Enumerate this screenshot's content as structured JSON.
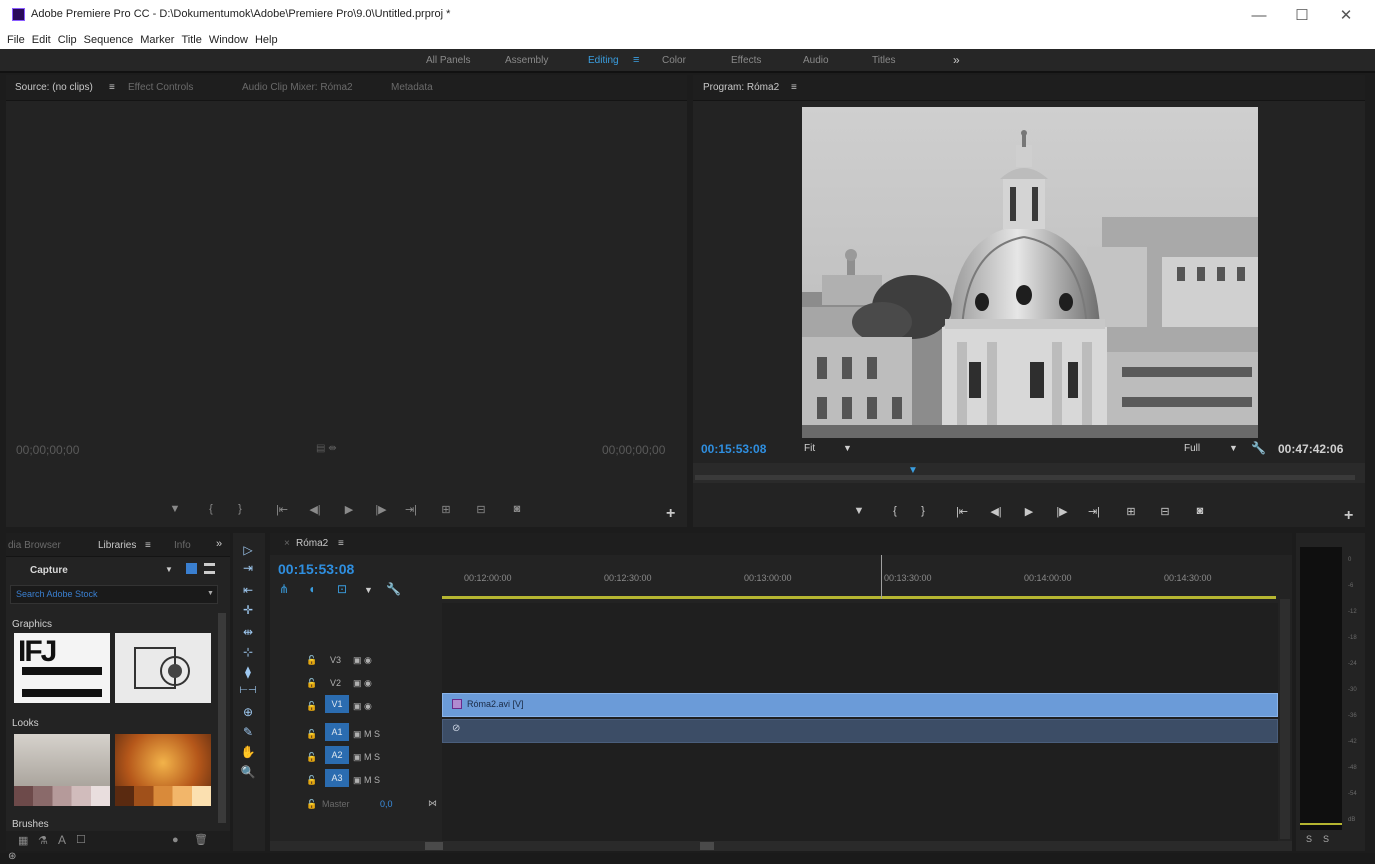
{
  "window": {
    "title": "Adobe Premiere Pro CC - D:\\Dokumentumok\\Adobe\\Premiere Pro\\9.0\\Untitled.prproj *",
    "min_glyph": "—",
    "max_glyph": "☐",
    "close_glyph": "✕"
  },
  "menu": [
    "File",
    "Edit",
    "Clip",
    "Sequence",
    "Marker",
    "Title",
    "Window",
    "Help"
  ],
  "workspaces": {
    "items": [
      "All Panels",
      "Assembly",
      "Editing",
      "Color",
      "Effects",
      "Audio",
      "Titles"
    ],
    "active": "Editing",
    "active_menu_glyph": "≡",
    "more_glyph": "»"
  },
  "source_panel": {
    "tabs": [
      "Source: (no clips)",
      "Effect Controls",
      "Audio Clip Mixer: Róma2",
      "Metadata"
    ],
    "tab_menu_glyph": "≡",
    "timecode_left": "00;00;00;00",
    "timecode_right": "00;00;00;00",
    "center_glyph": "▤ ⇼",
    "controls": [
      "▼",
      "{",
      "}",
      "|⇤",
      "◀|",
      "▶",
      "|▶",
      "⇥|",
      "⊞",
      "⊟",
      "◙"
    ],
    "add_glyph": "+"
  },
  "program_panel": {
    "tab": "Program: Róma2",
    "tab_menu_glyph": "≡",
    "timecode": "00:15:53:08",
    "fit": "Fit",
    "resolution": "Full",
    "duration": "00:47:42:06",
    "dropdown_glyph": "▼",
    "wrench_glyph": "🔧",
    "playhead_glyph": "▼",
    "controls": [
      "▼",
      "{",
      "}",
      "|⇤",
      "◀|",
      "▶",
      "|▶",
      "⇥|",
      "⊞",
      "⊟",
      "◙"
    ],
    "add_glyph": "+"
  },
  "library_panel": {
    "tabs": [
      "dia Browser",
      "Libraries",
      "Info"
    ],
    "tab_menu_glyph": "≡",
    "more_glyph": "»",
    "library_name": "Capture",
    "search_placeholder": "Search Adobe Stock",
    "sections": {
      "graphics": "Graphics",
      "looks": "Looks",
      "brushes": "Brushes"
    },
    "graphic_text": "IFJ",
    "bottom_icons": [
      "▦",
      "⚗",
      "A",
      "☐"
    ],
    "bottom_right_icons": [
      "●",
      "🗑"
    ]
  },
  "timeline": {
    "tab": "Róma2",
    "tab_menu_glyph": "≡",
    "close_glyph": "×",
    "timecode": "00:15:53:08",
    "ruler": [
      "00:12:00:00",
      "00:12:30:00",
      "00:13:00:00",
      "00:13:30:00",
      "00:14:00:00",
      "00:14:30:00"
    ],
    "tool_glyphs": [
      "⋔",
      "◖",
      "⊡",
      "▼",
      "🔧"
    ],
    "video_tracks": [
      "V3",
      "V2",
      "V1"
    ],
    "audio_tracks": [
      "A1",
      "A2",
      "A3"
    ],
    "lock_glyph": "🔓",
    "video_track_icons": "▣ ◉",
    "audio_track_icons": "▣ M S",
    "master_label": "Master",
    "master_value": "0,0",
    "master_end_glyph": "⋈",
    "video_clip": "Róma2.avi [V]",
    "audio_clip_glyph": "⊘"
  },
  "tools": [
    "▷",
    "⇥",
    "⇤",
    "✛",
    "⇹",
    "⊹",
    "⧫",
    "⊢⊣",
    "⊕",
    "✎",
    "✋",
    "🔍"
  ],
  "audio_meter": {
    "scale": [
      "0",
      "-6",
      "-12",
      "-18",
      "-24",
      "-30",
      "-36",
      "-42",
      "-48",
      "-54",
      "dB"
    ],
    "channels": [
      "S",
      "S"
    ]
  },
  "status": {
    "glyph": "⊛"
  },
  "colors": {
    "accent": "#2f8fe0",
    "video_clip": "#6b9bd8",
    "audio_clip": "#3c4d66",
    "ruler_bar": "#b6b631"
  }
}
